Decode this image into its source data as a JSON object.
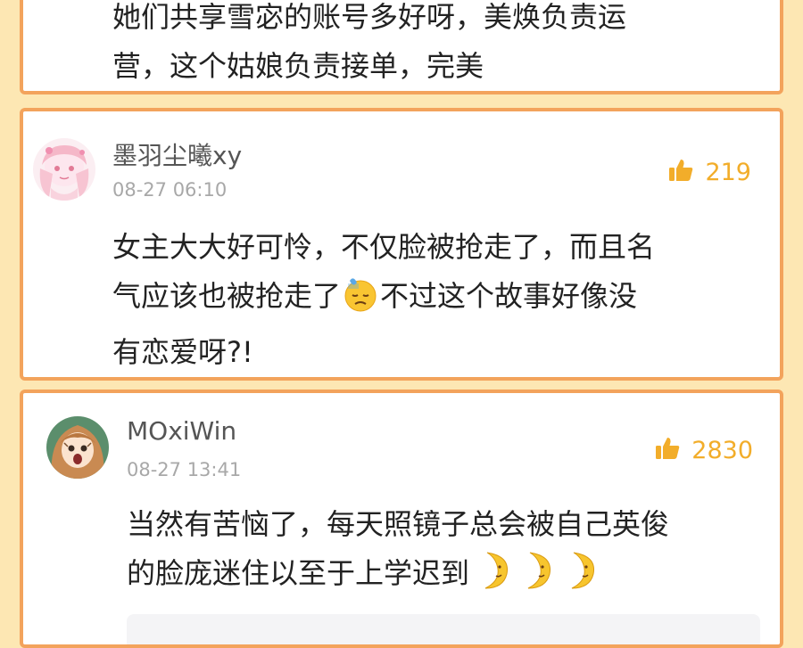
{
  "comments": [
    {
      "lines": [
        "她们共享雪宓的账号多好呀，美焕负责运",
        "营，这个姑娘负责接单，完美"
      ]
    },
    {
      "username": "墨羽尘曦xy",
      "timestamp": "08-27 06:10",
      "likes": "219",
      "line1": "女主大大好可怜，不仅脸被抢走了，而且名",
      "line2a": "气应该也被抢走了",
      "line2_emoji": "sweat-face-icon",
      "line2b": "不过这个故事好像没",
      "line3": "有恋爱呀?!"
    },
    {
      "username": "MOxiWin",
      "timestamp": "08-27 13:41",
      "likes": "2830",
      "line1": "当然有苦恼了，每天照镜子总会被自己英俊",
      "line2": "的脸庞迷住以至于上学迟到",
      "line2_emoji": "crescent-moon-face-icon"
    }
  ],
  "colors": {
    "background": "#fde7b3",
    "card_border": "#f3a35c",
    "like_accent": "#f2ad2a",
    "username": "#555555",
    "timestamp": "#a8a8a8",
    "body_text": "#222222"
  }
}
